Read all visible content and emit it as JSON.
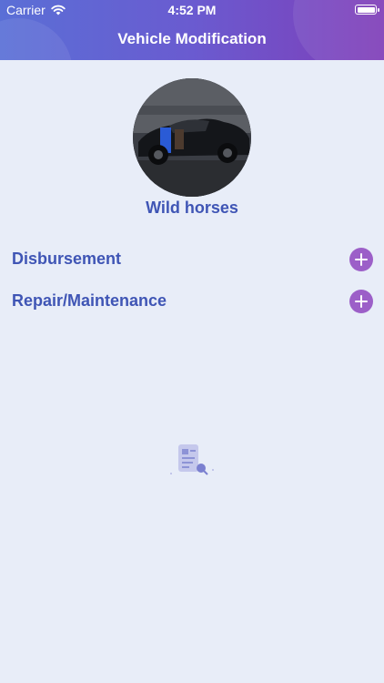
{
  "status_bar": {
    "carrier": "Carrier",
    "time": "4:52 PM",
    "wifi_icon": "wifi-icon",
    "battery_icon": "battery-icon"
  },
  "header": {
    "title": "Vehicle Modification",
    "gradient": [
      "#5a6fd6",
      "#7f3db8"
    ]
  },
  "vehicle": {
    "name": "Wild horses",
    "photo": "car-photo"
  },
  "sections": [
    {
      "label": "Disbursement",
      "action_icon": "plus-circle-icon"
    },
    {
      "label": "Repair/Maintenance",
      "action_icon": "plus-circle-icon"
    }
  ],
  "empty_state": {
    "icon": "document-search-icon"
  },
  "colors": {
    "accent_text": "#3f55b5",
    "add_button": "#9c5fc8",
    "background": "#e8edf8"
  }
}
